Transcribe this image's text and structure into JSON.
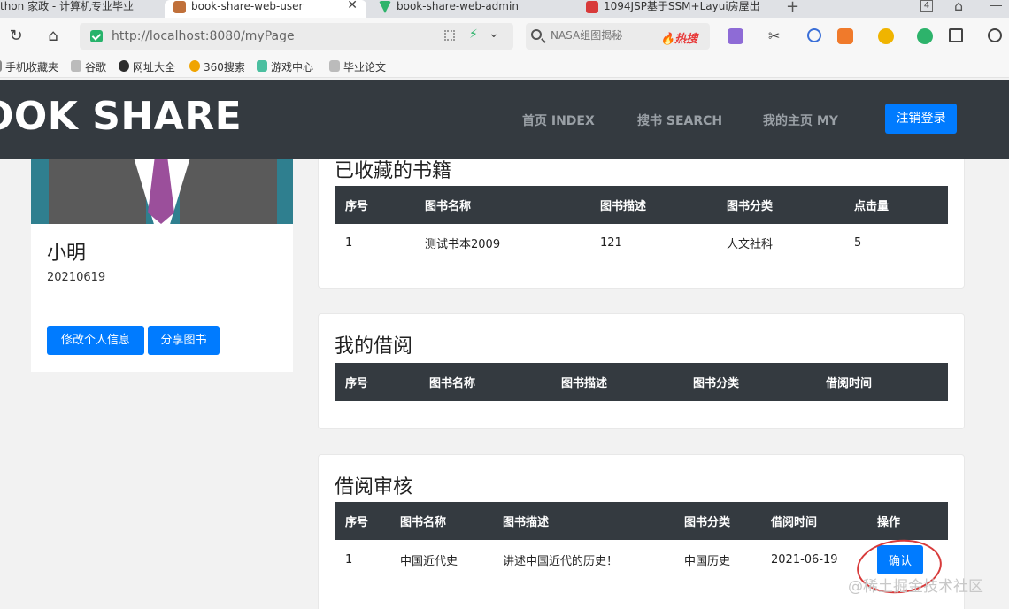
{
  "browser": {
    "tabs": [
      {
        "title": "thon 家政 - 计算机专业毕业",
        "icon_color": "#3a7bd5"
      },
      {
        "title": "book-share-web-user",
        "icon_color": "#c0703a"
      },
      {
        "title": "book-share-web-admin",
        "icon_color": "#2fb36b"
      },
      {
        "title": "1094JSP基于SSM+Layui房屋出",
        "icon_color": "#d83a3a"
      }
    ],
    "tab_count": "4",
    "url": "http://localhost:8080/myPage",
    "search_placeholder": "NASA组图揭秘",
    "search_hot": "🔥热搜",
    "bookmarks": [
      {
        "label": "手机收藏夹",
        "icon_color": "#8a8a8a"
      },
      {
        "label": "谷歌",
        "icon_color": "#bbbbbb"
      },
      {
        "label": "网址大全",
        "icon_color": "#2c2c2c"
      },
      {
        "label": "360搜索",
        "icon_color": "#f0a400"
      },
      {
        "label": "游戏中心",
        "icon_color": "#4bbfa0"
      },
      {
        "label": "毕业论文",
        "icon_color": "#bbbbbb"
      }
    ]
  },
  "navbar": {
    "brand": "OOK SHARE",
    "links": [
      "首页 INDEX",
      "搜书 SEARCH",
      "我的主页 MY"
    ],
    "logout": "注销登录"
  },
  "profile": {
    "name": "小明",
    "id": "20210619",
    "edit_button": "修改个人信息",
    "share_button": "分享图书"
  },
  "favorites": {
    "title": "已收藏的书籍",
    "headers": [
      "序号",
      "图书名称",
      "图书描述",
      "图书分类",
      "点击量"
    ],
    "rows": [
      [
        "1",
        "测试书本2009",
        "121",
        "人文社科",
        "5"
      ]
    ]
  },
  "borrows": {
    "title": "我的借阅",
    "headers": [
      "序号",
      "图书名称",
      "图书描述",
      "图书分类",
      "借阅时间"
    ]
  },
  "review": {
    "title": "借阅审核",
    "headers": [
      "序号",
      "图书名称",
      "图书描述",
      "图书分类",
      "借阅时间",
      "操作"
    ],
    "rows": [
      [
        "1",
        "中国近代史",
        "讲述中国近代的历史！",
        "中国历史",
        "2021-06-19"
      ]
    ],
    "confirm": "确认"
  },
  "watermark": "@稀土掘金技术社区",
  "colors": {
    "primary": "#007bff",
    "navbar": "#343a40",
    "annotation": "#d83a3a"
  }
}
